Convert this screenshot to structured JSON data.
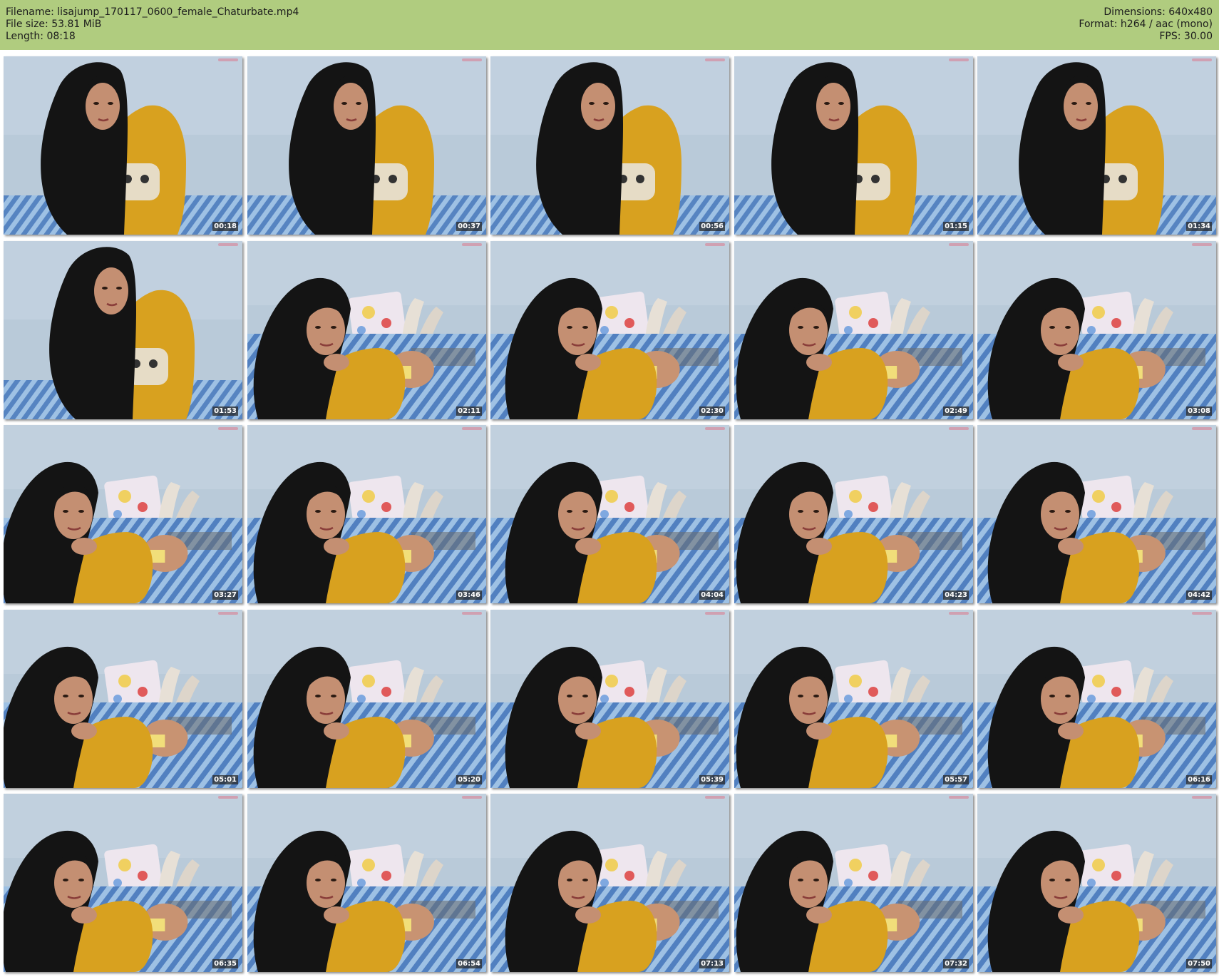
{
  "header": {
    "filename": "Filename: lisajump_170117_0600_female_Chaturbate.mp4",
    "filesize": "File size: 53.81 MiB",
    "length": "Length: 08:18",
    "dimensions": "Dimensions: 640x480",
    "format": "Format: h264 / aac (mono)",
    "fps": "FPS: 30.00"
  },
  "thumbnails": [
    {
      "time": "00:18",
      "pose": "sitting"
    },
    {
      "time": "00:37",
      "pose": "sitting"
    },
    {
      "time": "00:56",
      "pose": "sitting"
    },
    {
      "time": "01:15",
      "pose": "sitting"
    },
    {
      "time": "01:34",
      "pose": "sitting"
    },
    {
      "time": "01:53",
      "pose": "sitting"
    },
    {
      "time": "02:11",
      "pose": "lying"
    },
    {
      "time": "02:30",
      "pose": "lying"
    },
    {
      "time": "02:49",
      "pose": "lying"
    },
    {
      "time": "03:08",
      "pose": "lying"
    },
    {
      "time": "03:27",
      "pose": "lying"
    },
    {
      "time": "03:46",
      "pose": "lying"
    },
    {
      "time": "04:04",
      "pose": "lying"
    },
    {
      "time": "04:23",
      "pose": "lying"
    },
    {
      "time": "04:42",
      "pose": "lying"
    },
    {
      "time": "05:01",
      "pose": "lying"
    },
    {
      "time": "05:20",
      "pose": "lying"
    },
    {
      "time": "05:39",
      "pose": "lying"
    },
    {
      "time": "05:57",
      "pose": "lying"
    },
    {
      "time": "06:16",
      "pose": "lying"
    },
    {
      "time": "06:35",
      "pose": "lying"
    },
    {
      "time": "06:54",
      "pose": "lying"
    },
    {
      "time": "07:13",
      "pose": "lying"
    },
    {
      "time": "07:32",
      "pose": "lying"
    },
    {
      "time": "07:50",
      "pose": "lying"
    }
  ],
  "colors": {
    "header_bg": "#b0cc7f",
    "wall": "#b9cad9",
    "sweater": "#d8a11f",
    "hair": "#141414",
    "skin": "#c48f72",
    "bedding_blue": "#3d6fb6",
    "bedding_light": "#9ec1e4"
  }
}
